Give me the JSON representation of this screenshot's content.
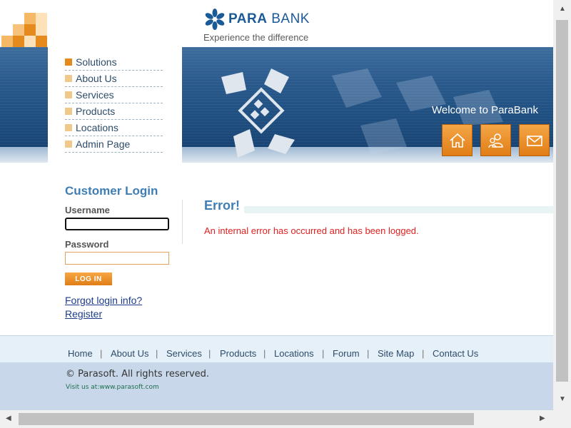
{
  "header": {
    "brand_bold": "PARA",
    "brand_rest": "BANK",
    "tagline": "Experience the difference",
    "welcome": "Welcome to ParaBank"
  },
  "nav": {
    "items": [
      {
        "label": "Solutions"
      },
      {
        "label": "About Us"
      },
      {
        "label": "Services"
      },
      {
        "label": "Products"
      },
      {
        "label": "Locations"
      },
      {
        "label": "Admin Page"
      }
    ]
  },
  "login": {
    "title": "Customer Login",
    "username_label": "Username",
    "username_value": "",
    "password_label": "Password",
    "password_value": "",
    "button": "LOG IN",
    "forgot": "Forgot login info?",
    "register": "Register"
  },
  "content": {
    "title": "Error!",
    "message": "An internal error has occurred and has been logged."
  },
  "footer": {
    "links": [
      "Home",
      "About Us",
      "Services",
      "Products",
      "Locations",
      "Forum",
      "Site Map",
      "Contact Us"
    ],
    "copyright": "© Parasoft. All rights reserved.",
    "visit": "Visit us at:www.parasoft.com"
  },
  "icons": {
    "header_buttons": [
      "home-icon",
      "contact-people-icon",
      "envelope-icon"
    ],
    "brand_logo": "parabank-flower-icon"
  },
  "colors": {
    "accent_orange": "#e58a1d",
    "brand_blue": "#1a5a96",
    "error_red": "#e02020"
  }
}
